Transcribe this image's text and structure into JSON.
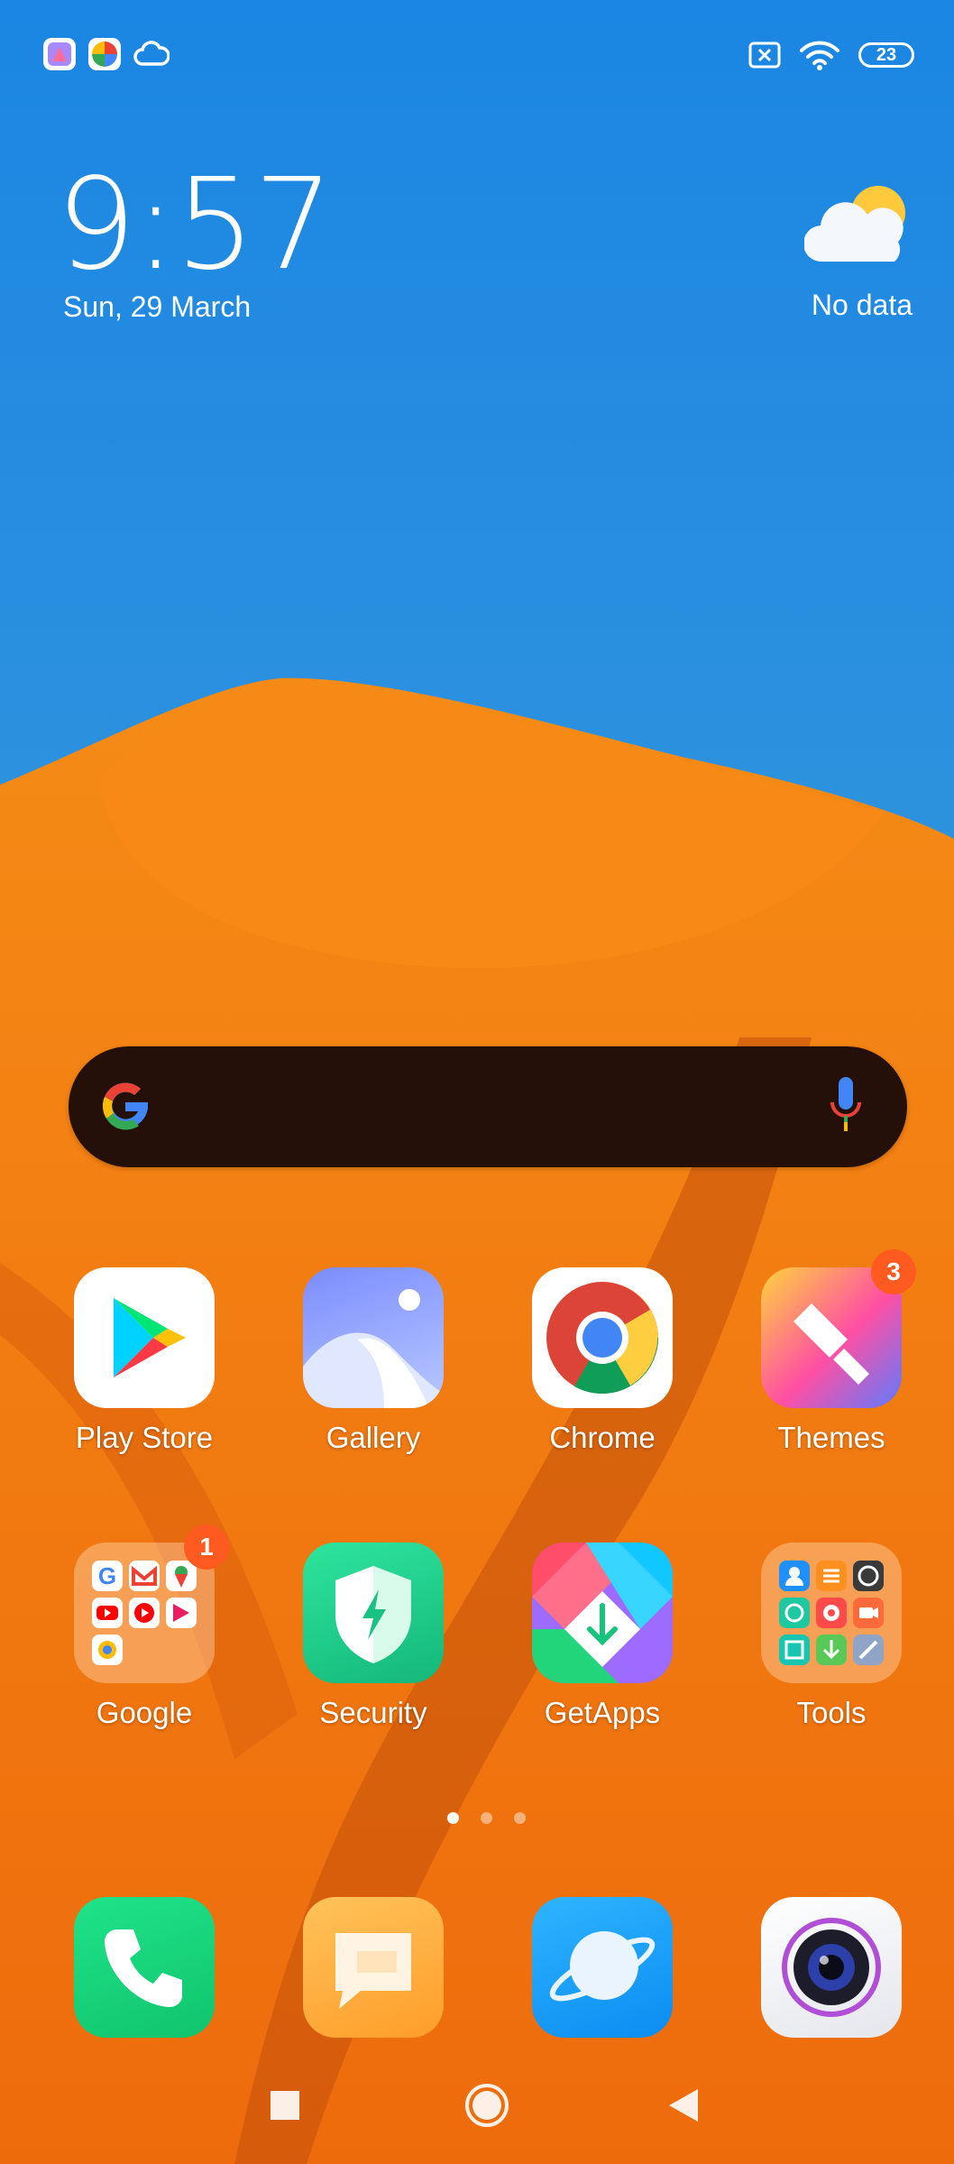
{
  "status_bar": {
    "notification_icons": [
      "gallery-notification-icon",
      "photos-notification-icon",
      "cloud-icon"
    ],
    "indicators": [
      "sim-off-icon",
      "wifi-icon"
    ],
    "battery": "23"
  },
  "clock_widget": {
    "time": "9:57",
    "date": "Sun, 29 March"
  },
  "weather_widget": {
    "icon": "partly-cloudy-icon",
    "text": "No data"
  },
  "search_bar": {
    "logo": "google-g-icon",
    "voice": "mic-icon"
  },
  "apps_row1": [
    {
      "label": "Play Store",
      "icon": "play-store-icon",
      "badge": ""
    },
    {
      "label": "Gallery",
      "icon": "gallery-icon",
      "badge": ""
    },
    {
      "label": "Chrome",
      "icon": "chrome-icon",
      "badge": ""
    },
    {
      "label": "Themes",
      "icon": "themes-icon",
      "badge": "3"
    }
  ],
  "apps_row2": [
    {
      "label": "Google",
      "icon": "google-folder-icon",
      "badge": "1"
    },
    {
      "label": "Security",
      "icon": "security-icon",
      "badge": ""
    },
    {
      "label": "GetApps",
      "icon": "getapps-icon",
      "badge": ""
    },
    {
      "label": "Tools",
      "icon": "tools-folder-icon",
      "badge": ""
    }
  ],
  "page_indicator": {
    "pages": 3,
    "current": 1
  },
  "dock": [
    {
      "icon": "phone-icon"
    },
    {
      "icon": "messages-icon"
    },
    {
      "icon": "browser-icon"
    },
    {
      "icon": "camera-icon"
    }
  ],
  "nav_bar": [
    "recents-button",
    "home-button",
    "back-button"
  ],
  "colors": {
    "sky": "#1f8fe0",
    "sand": "#f07a10",
    "badge": "#ff5a1f",
    "search_bar": "#241008"
  }
}
